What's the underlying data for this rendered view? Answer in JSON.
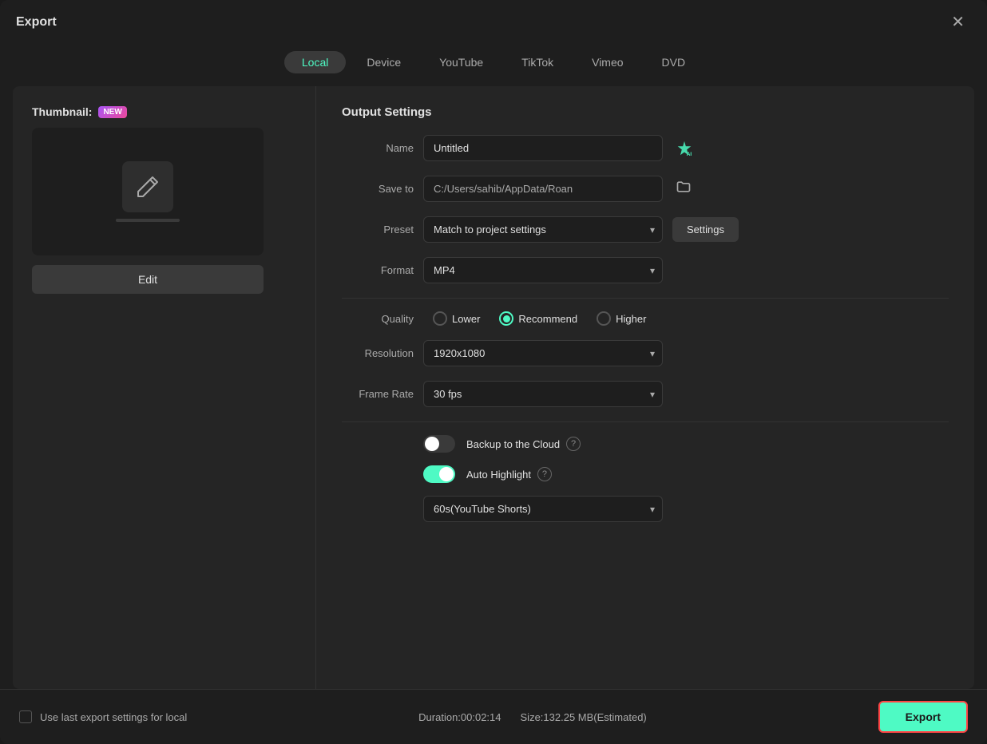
{
  "dialog": {
    "title": "Export",
    "close_label": "✕"
  },
  "tabs": [
    {
      "id": "local",
      "label": "Local",
      "active": true
    },
    {
      "id": "device",
      "label": "Device",
      "active": false
    },
    {
      "id": "youtube",
      "label": "YouTube",
      "active": false
    },
    {
      "id": "tiktok",
      "label": "TikTok",
      "active": false
    },
    {
      "id": "vimeo",
      "label": "Vimeo",
      "active": false
    },
    {
      "id": "dvd",
      "label": "DVD",
      "active": false
    }
  ],
  "left_panel": {
    "thumbnail_label": "Thumbnail:",
    "new_badge": "NEW",
    "edit_button": "Edit"
  },
  "right_panel": {
    "section_title": "Output Settings",
    "name_label": "Name",
    "name_value": "Untitled",
    "save_to_label": "Save to",
    "save_to_value": "C:/Users/sahib/AppData/Roan",
    "preset_label": "Preset",
    "preset_value": "Match to project settings",
    "settings_button": "Settings",
    "format_label": "Format",
    "format_value": "MP4",
    "quality_label": "Quality",
    "quality_options": [
      {
        "label": "Lower",
        "checked": false
      },
      {
        "label": "Recommend",
        "checked": true
      },
      {
        "label": "Higher",
        "checked": false
      }
    ],
    "resolution_label": "Resolution",
    "resolution_value": "1920x1080",
    "frame_rate_label": "Frame Rate",
    "frame_rate_value": "30 fps",
    "backup_label": "Backup to the Cloud",
    "backup_toggle": "off",
    "auto_highlight_label": "Auto Highlight",
    "auto_highlight_toggle": "on",
    "highlight_duration": "60s(YouTube Shorts)"
  },
  "footer": {
    "use_last_settings_label": "Use last export settings for local",
    "duration_label": "Duration:00:02:14",
    "size_label": "Size:132.25 MB(Estimated)",
    "export_button": "Export"
  }
}
